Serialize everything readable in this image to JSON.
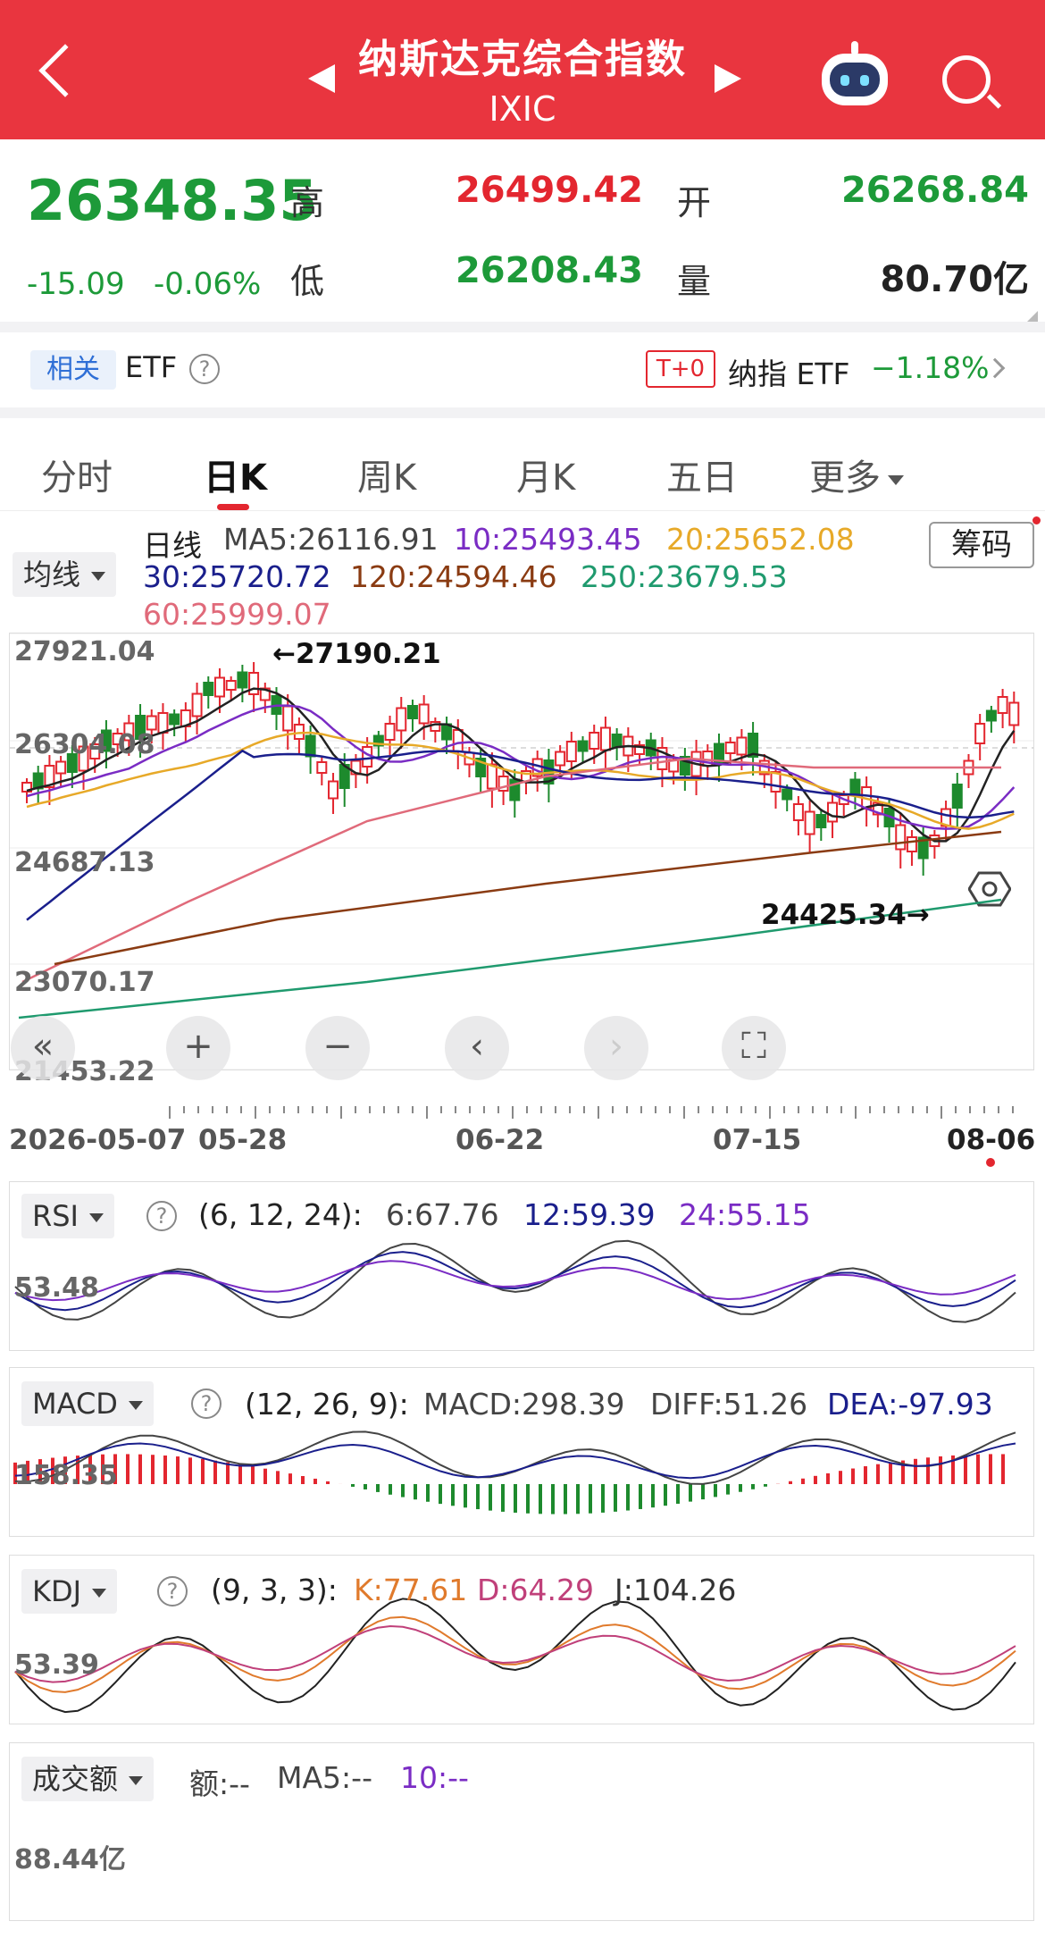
{
  "header": {
    "title": "纳斯达克综合指数",
    "code": "IXIC"
  },
  "quote": {
    "price": "26348.35",
    "change": "-15.09",
    "change_pct": "-0.06%",
    "high_label": "高",
    "high": "26499.42",
    "open_label": "开",
    "open": "26268.84",
    "low_label": "低",
    "low": "26208.43",
    "volume_label": "量",
    "volume": "80.70亿"
  },
  "etf": {
    "related_label": "相关",
    "etf_label": "ETF",
    "t0_label": "T+0",
    "nasdaq_etf_label": "纳指 ETF",
    "nasdaq_etf_change": "−1.18%"
  },
  "tabs": [
    "分时",
    "日K",
    "周K",
    "月K",
    "五日",
    "更多"
  ],
  "kline": {
    "ma_dropdown": "均线",
    "period_label": "日线",
    "ma5": "MA5:26116.91",
    "ma10": "10:25493.45",
    "ma20": "20:25652.08",
    "ma30": "30:25720.72",
    "ma120": "120:24594.46",
    "ma250": "250:23679.53",
    "ma60": "60:25999.07",
    "chip_button": "筹码",
    "y_labels": [
      "27921.04",
      "26304.08",
      "24687.13",
      "23070.17",
      "21453.22"
    ],
    "high_annot": "←27190.21",
    "low_annot": "24425.34→",
    "dates": [
      "2026-05-07",
      "05-28",
      "06-22",
      "07-15",
      "08-06"
    ],
    "colors": {
      "ma5": "#222222",
      "ma10": "#1a1f8c",
      "ma20": "#e7a928",
      "ma30": "#1a1f8c",
      "ma60": "#e06a7a",
      "ma120": "#8a3b12",
      "ma250": "#1f9a6e",
      "up": "#e3262f",
      "down": "#1d8a2d"
    }
  },
  "rsi": {
    "name": "RSI",
    "params": "(6, 12, 24):",
    "v6": "6:67.76",
    "v12": "12:59.39",
    "v24": "24:55.15",
    "level": "53.48"
  },
  "macd": {
    "name": "MACD",
    "params": "(12, 26, 9):",
    "macd": "MACD:298.39",
    "diff": "DIFF:51.26",
    "dea": "DEA:-97.93",
    "level": "158.35"
  },
  "kdj": {
    "name": "KDJ",
    "params": "(9, 3, 3):",
    "k": "K:77.61",
    "d": "D:64.29",
    "j": "J:104.26",
    "level": "53.39"
  },
  "turnover": {
    "name": "成交额",
    "amount": "额:--",
    "ma5": "MA5:--",
    "ma10": "10:--",
    "level": "88.44亿"
  }
}
